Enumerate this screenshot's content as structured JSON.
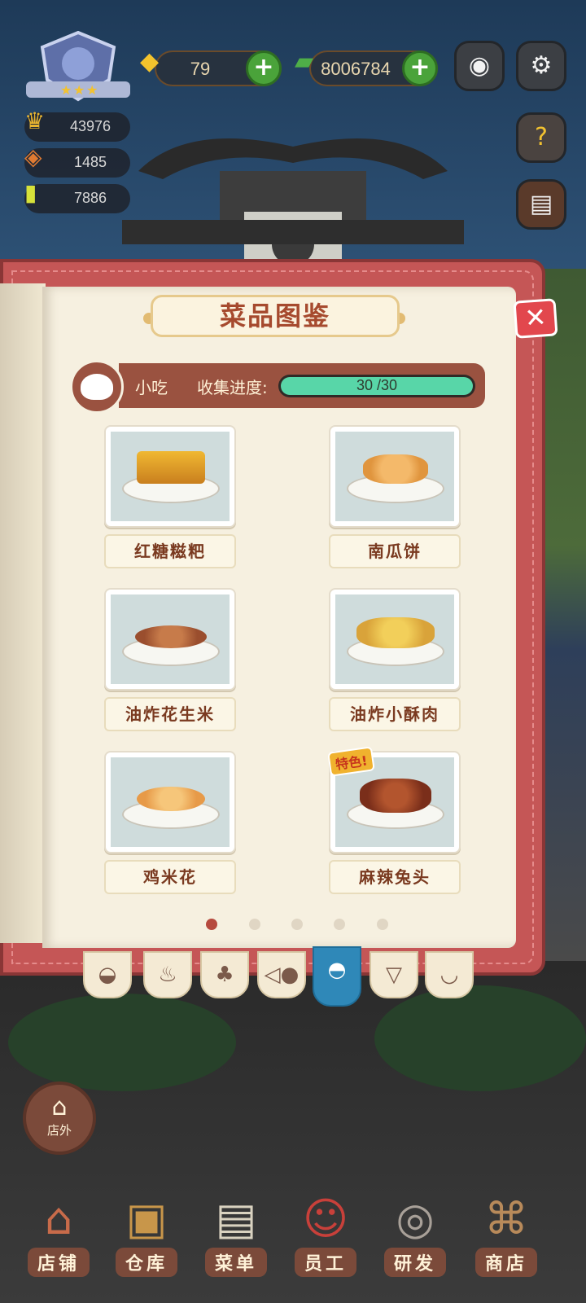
{
  "hud": {
    "gem_count": "79",
    "cash_count": "8006784",
    "stat1": "43976",
    "stat2": "1485",
    "stat3": "7886"
  },
  "panel": {
    "title": "菜品图鉴",
    "category_label": "小吃",
    "progress_label": "收集进度:",
    "progress_text": "30 /30",
    "progress_value": 1.0
  },
  "dishes": [
    {
      "name": "红糖糍粑"
    },
    {
      "name": "南瓜饼"
    },
    {
      "name": "油炸花生米"
    },
    {
      "name": "油炸小酥肉"
    },
    {
      "name": "鸡米花"
    },
    {
      "name": "麻辣兔头",
      "tag": "特色!"
    }
  ],
  "pagination": {
    "pages": 5,
    "current": 1
  },
  "tabs": [
    "wok-icon",
    "drumstick-icon",
    "broccoli-icon",
    "fish-icon",
    "bun-icon",
    "wine-glass-icon",
    "dessert-icon"
  ],
  "outside_button": {
    "label": "店外"
  },
  "bottom_nav": [
    {
      "label": "店铺",
      "icon": "shop-icon"
    },
    {
      "label": "仓库",
      "icon": "warehouse-icon"
    },
    {
      "label": "菜单",
      "icon": "menu-clipboard-icon"
    },
    {
      "label": "员工",
      "icon": "staff-icon"
    },
    {
      "label": "研发",
      "icon": "research-pot-icon"
    },
    {
      "label": "商店",
      "icon": "store-icon"
    }
  ],
  "colors": {
    "accent_red": "#c55656",
    "progress": "#58d6a8",
    "active_tab": "#2f88b8"
  }
}
